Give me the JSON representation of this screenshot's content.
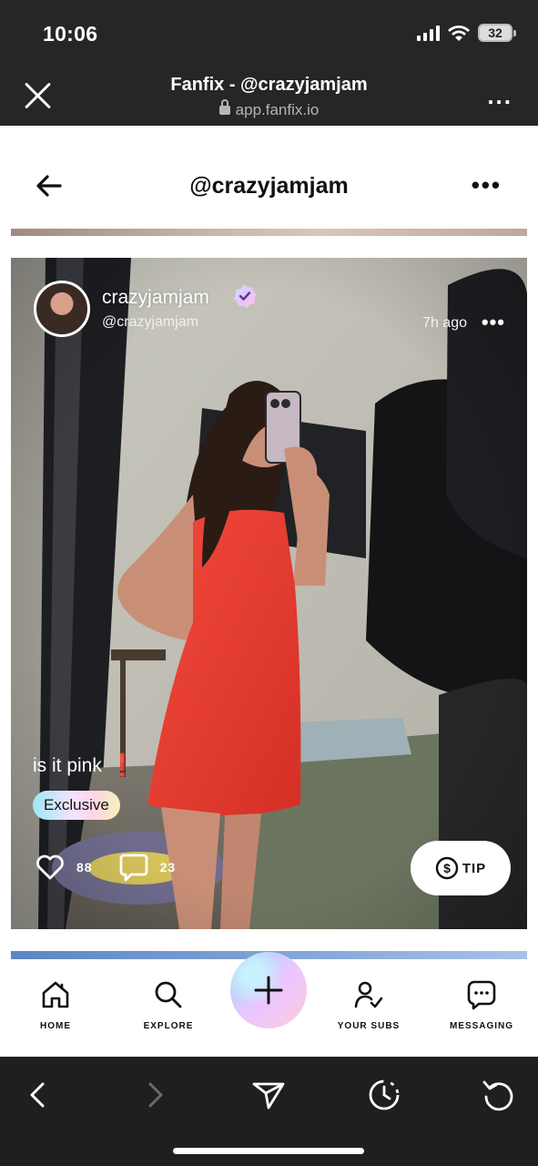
{
  "status_bar": {
    "time": "10:06",
    "battery": "32"
  },
  "browser": {
    "title": "Fanfix - @crazyjamjam",
    "url": "app.fanfix.io",
    "more_label": "..."
  },
  "header": {
    "title": "@crazyjamjam",
    "more_label": "•••"
  },
  "post": {
    "author_name": "crazyjamjam",
    "author_handle": "@crazyjamjam",
    "time": "7h ago",
    "more_label": "•••",
    "caption": "is it pink",
    "caption_emoji": "❗",
    "badge": "Exclusive",
    "likes": "88",
    "comments": "23",
    "tip_label": "TIP"
  },
  "nav": {
    "items": [
      {
        "label": "HOME",
        "icon": "home-icon"
      },
      {
        "label": "EXPLORE",
        "icon": "search-icon"
      },
      {
        "label": "YOUR SUBS",
        "icon": "subscriptions-icon"
      },
      {
        "label": "MESSAGING",
        "icon": "chat-icon"
      }
    ],
    "create_icon": "plus-icon"
  },
  "colors": {
    "chrome_bg": "#262626",
    "toolbar_bg": "#1f1f1f",
    "dress_red": "#ef3b30",
    "gradient_cyan": "#8de0f6",
    "gradient_pink": "#ffc9df",
    "gradient_violet": "#e9c6ff"
  }
}
